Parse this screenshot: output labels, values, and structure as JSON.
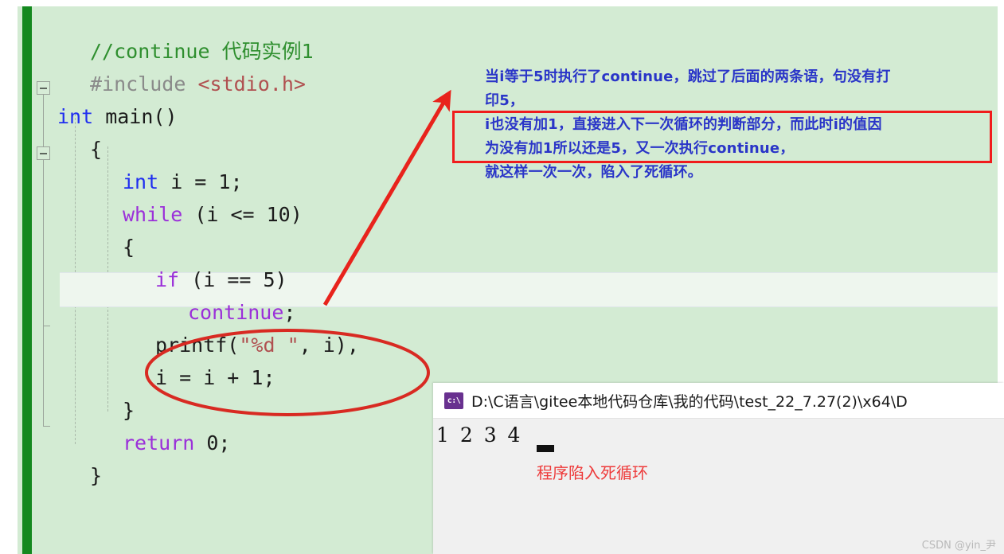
{
  "editor": {
    "background_color": "#d3ebd3",
    "change_bar_color": "#14891f",
    "current_line_color": "#eef6ee",
    "code_lines": [
      {
        "indent": 1,
        "segments": [
          {
            "cls": "cmt",
            "text": "//continue 代码实例1"
          }
        ]
      },
      {
        "indent": 1,
        "segments": [
          {
            "cls": "pp",
            "text": "#include "
          },
          {
            "cls": "str",
            "text": "<stdio.h>"
          }
        ]
      },
      {
        "indent": 0,
        "segments": [
          {
            "cls": "kw",
            "text": "int"
          },
          {
            "cls": "plain",
            "text": " main()"
          }
        ]
      },
      {
        "indent": 1,
        "segments": [
          {
            "cls": "plain",
            "text": "{"
          }
        ]
      },
      {
        "indent": 2,
        "segments": [
          {
            "cls": "kw",
            "text": "int"
          },
          {
            "cls": "plain",
            "text": " i = 1;"
          }
        ]
      },
      {
        "indent": 2,
        "segments": [
          {
            "cls": "kw2",
            "text": "while"
          },
          {
            "cls": "plain",
            "text": " (i <= 10)"
          }
        ]
      },
      {
        "indent": 2,
        "segments": [
          {
            "cls": "plain",
            "text": "{"
          }
        ]
      },
      {
        "indent": 3,
        "segments": [
          {
            "cls": "kw2",
            "text": "if"
          },
          {
            "cls": "plain",
            "text": " (i == 5)"
          }
        ]
      },
      {
        "indent": 4,
        "segments": [
          {
            "cls": "kw2",
            "text": "continue"
          },
          {
            "cls": "plain",
            "text": ";"
          }
        ]
      },
      {
        "indent": 3,
        "segments": [
          {
            "cls": "plain",
            "text": "printf("
          },
          {
            "cls": "str",
            "text": "\"%d \""
          },
          {
            "cls": "plain",
            "text": ", i),"
          }
        ]
      },
      {
        "indent": 3,
        "segments": [
          {
            "cls": "plain",
            "text": "i = i + 1;"
          }
        ]
      },
      {
        "indent": 2,
        "segments": [
          {
            "cls": "plain",
            "text": "}"
          }
        ]
      },
      {
        "indent": 2,
        "segments": [
          {
            "cls": "kw2",
            "text": "return"
          },
          {
            "cls": "plain",
            "text": " 0;"
          }
        ]
      },
      {
        "indent": 1,
        "segments": [
          {
            "cls": "plain",
            "text": "}"
          }
        ]
      }
    ],
    "highlighted_line_text": "if (i == 5)"
  },
  "annotation": {
    "color": "#2a35c8",
    "box_color": "#f01c1c",
    "lines": [
      "当i等于5时执行了continue，跳过了后面的两条语，句没有打",
      "印5，",
      "i也没有加1，直接进入下一次循环的判断部分，而此时i的值因",
      "为没有加1所以还是5，又一次执行continue，",
      "就这样一次一次，陷入了死循环。"
    ],
    "boxed_line_indices": [
      2,
      3
    ]
  },
  "markup": {
    "arrow_color": "#e8231c",
    "ellipse_color": "#d82a22",
    "arrow_from": "408,383",
    "arrow_to": "562,122"
  },
  "console": {
    "icon_label": "c:\\",
    "title": "D:\\C语言\\gitee本地代码仓库\\我的代码\\test_22_7.27(2)\\x64\\D",
    "output": "1 2 3 4",
    "note": "程序陷入死循环",
    "note_color": "#ee3a3a"
  },
  "watermark": {
    "text": "CSDN @yin_尹"
  }
}
